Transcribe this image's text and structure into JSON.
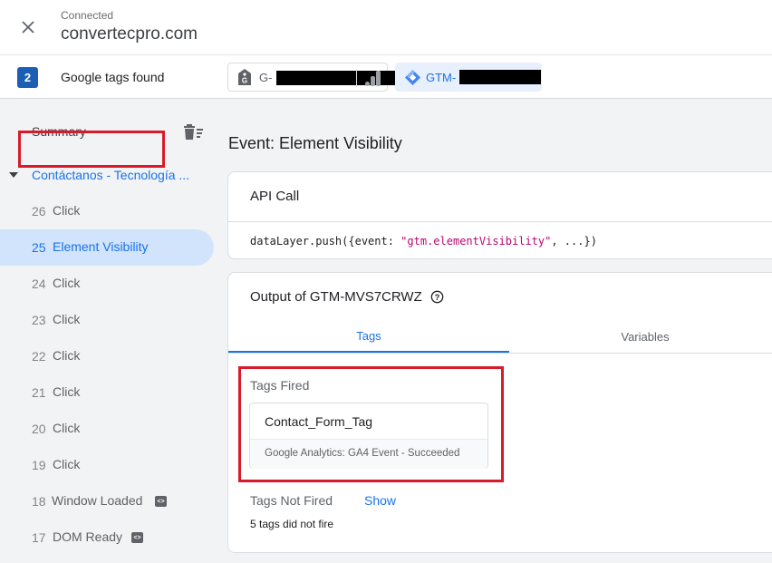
{
  "header": {
    "status": "Connected",
    "domain": "convertecpro.com",
    "close_icon": "close-icon"
  },
  "tags_bar": {
    "count": "2",
    "label": "Google tags found",
    "chips": [
      {
        "prefix": "G-",
        "icon": "google-tag-icon",
        "secondary_icon": "analytics-bars-icon",
        "redacted": true
      },
      {
        "prefix": "GTM-",
        "icon": "gtm-icon",
        "redacted": true,
        "selected": true
      }
    ]
  },
  "sidebar": {
    "summary": "Summary",
    "page": "Contáctanos - Tecnología ...",
    "events": [
      {
        "num": "26",
        "name": "Click"
      },
      {
        "num": "25",
        "name": "Element Visibility",
        "active": true
      },
      {
        "num": "24",
        "name": "Click"
      },
      {
        "num": "23",
        "name": "Click"
      },
      {
        "num": "22",
        "name": "Click"
      },
      {
        "num": "21",
        "name": "Click"
      },
      {
        "num": "20",
        "name": "Click"
      },
      {
        "num": "19",
        "name": "Click"
      },
      {
        "num": "18",
        "name": "Window Loaded",
        "badge": "<>"
      },
      {
        "num": "17",
        "name": "DOM Ready",
        "badge": "<>"
      }
    ]
  },
  "main": {
    "event_title": "Event: Element Visibility",
    "api_call": {
      "heading": "API Call",
      "code_prefix": "dataLayer.push({event: ",
      "code_string": "\"gtm.elementVisibility\"",
      "code_suffix": ", ...})"
    },
    "output": {
      "heading": "Output of GTM-MVS7CRWZ",
      "tabs": [
        "Tags",
        "Variables"
      ],
      "active_tab": "Tags",
      "tags_fired_label": "Tags Fired",
      "fired_tag": {
        "name": "Contact_Form_Tag",
        "status": "Google Analytics: GA4 Event - Succeeded"
      },
      "tags_not_fired_label": "Tags Not Fired",
      "show_link": "Show",
      "not_fired_count": "5 tags did not fire"
    }
  },
  "colors": {
    "accent": "#1a73e8",
    "highlight_box": "#d81b2b",
    "active_bg": "#d2e3fc",
    "sidebar_bg": "#f1f3f4"
  }
}
